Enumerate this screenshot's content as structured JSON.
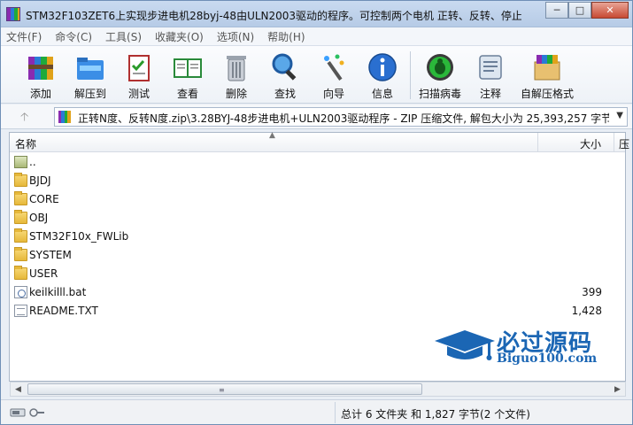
{
  "window": {
    "title": "STM32F103ZET6上实现步进电机28byj-48由ULN2003驱动的程序。可控制两个电机 正转、反转、停止...",
    "buttons": [
      "minimize-icon",
      "maximize-icon",
      "close-icon"
    ]
  },
  "menu": [
    "文件(F)",
    "命令(C)",
    "工具(S)",
    "收藏夹(O)",
    "选项(N)",
    "帮助(H)"
  ],
  "toolbar": [
    {
      "label": "添加",
      "icon": "add-archive-icon"
    },
    {
      "label": "解压到",
      "icon": "extract-to-icon"
    },
    {
      "label": "测试",
      "icon": "test-icon"
    },
    {
      "label": "查看",
      "icon": "view-icon"
    },
    {
      "label": "删除",
      "icon": "delete-icon"
    },
    {
      "label": "查找",
      "icon": "find-icon"
    },
    {
      "label": "向导",
      "icon": "wizard-icon"
    },
    {
      "label": "信息",
      "icon": "info-icon"
    },
    {
      "label": "扫描病毒",
      "icon": "virus-scan-icon"
    },
    {
      "label": "注释",
      "icon": "comment-icon"
    },
    {
      "label": "自解压格式",
      "icon": "sfx-icon"
    }
  ],
  "address": {
    "text": "正转N度、反转N度.zip\\3.28BYJ-48步进电机+ULN2003驱动程序 - ZIP 压缩文件, 解包大小为 25,393,257 字节"
  },
  "columns": {
    "name": "名称",
    "size": "大小",
    "extra": "压"
  },
  "files": [
    {
      "name": "..",
      "size": "",
      "type": "parent"
    },
    {
      "name": "BJDJ",
      "size": "",
      "type": "folder"
    },
    {
      "name": "CORE",
      "size": "",
      "type": "folder"
    },
    {
      "name": "OBJ",
      "size": "",
      "type": "folder"
    },
    {
      "name": "STM32F10x_FWLib",
      "size": "",
      "type": "folder"
    },
    {
      "name": "SYSTEM",
      "size": "",
      "type": "folder"
    },
    {
      "name": "USER",
      "size": "",
      "type": "folder"
    },
    {
      "name": "keilkilll.bat",
      "size": "399",
      "type": "bat"
    },
    {
      "name": "README.TXT",
      "size": "1,428",
      "type": "txt"
    }
  ],
  "watermark": {
    "title": "必过源码",
    "subtitle": "Biguo100.com"
  },
  "status": {
    "text": "总计 6 文件夹 和 1,827 字节(2 个文件)"
  },
  "colors": {
    "accent": "#1b66b4",
    "folder": "#e6b83a"
  }
}
